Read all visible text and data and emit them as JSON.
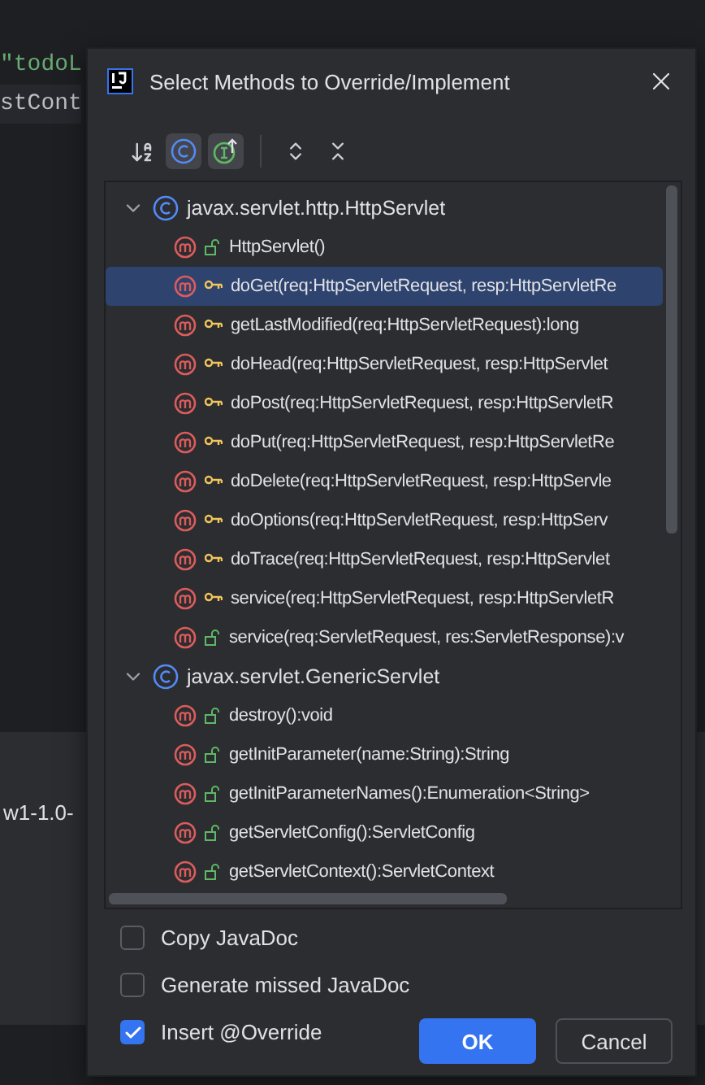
{
  "background": {
    "code_lines": [
      "\"todoL",
      "stCont"
    ],
    "console_text": "w1-1.0-"
  },
  "dialog": {
    "title": "Select Methods to Override/Implement",
    "toolbar": [
      {
        "kind": "sort",
        "selected": false
      },
      {
        "kind": "class",
        "selected": true
      },
      {
        "kind": "interface",
        "selected": true
      },
      {
        "kind": "expand",
        "selected": false
      },
      {
        "kind": "collapse",
        "selected": false
      }
    ],
    "groups": [
      {
        "name": "javax.servlet.http.HttpServlet",
        "expanded": true,
        "children": [
          {
            "label": "HttpServlet()",
            "kind": "public",
            "selected": false
          },
          {
            "label": "doGet(req:HttpServletRequest, resp:HttpServletRe",
            "kind": "protected",
            "selected": true
          },
          {
            "label": "getLastModified(req:HttpServletRequest):long",
            "kind": "protected",
            "selected": false
          },
          {
            "label": "doHead(req:HttpServletRequest, resp:HttpServlet",
            "kind": "protected",
            "selected": false
          },
          {
            "label": "doPost(req:HttpServletRequest, resp:HttpServletR",
            "kind": "protected",
            "selected": false
          },
          {
            "label": "doPut(req:HttpServletRequest, resp:HttpServletRe",
            "kind": "protected",
            "selected": false
          },
          {
            "label": "doDelete(req:HttpServletRequest, resp:HttpServle",
            "kind": "protected",
            "selected": false
          },
          {
            "label": "doOptions(req:HttpServletRequest, resp:HttpServ",
            "kind": "protected",
            "selected": false
          },
          {
            "label": "doTrace(req:HttpServletRequest, resp:HttpServlet",
            "kind": "protected",
            "selected": false
          },
          {
            "label": "service(req:HttpServletRequest, resp:HttpServletR",
            "kind": "protected",
            "selected": false
          },
          {
            "label": "service(req:ServletRequest, res:ServletResponse):v",
            "kind": "public",
            "selected": false
          }
        ]
      },
      {
        "name": "javax.servlet.GenericServlet",
        "expanded": true,
        "children": [
          {
            "label": "destroy():void",
            "kind": "public",
            "selected": false
          },
          {
            "label": "getInitParameter(name:String):String",
            "kind": "public",
            "selected": false
          },
          {
            "label": "getInitParameterNames():Enumeration<String>",
            "kind": "public",
            "selected": false
          },
          {
            "label": "getServletConfig():ServletConfig",
            "kind": "public",
            "selected": false
          },
          {
            "label": "getServletContext():ServletContext",
            "kind": "public",
            "selected": false
          }
        ]
      }
    ],
    "options": [
      {
        "label": "Copy JavaDoc",
        "checked": false
      },
      {
        "label": "Generate missed JavaDoc",
        "checked": false
      },
      {
        "label": "Insert @Override",
        "checked": true
      }
    ],
    "buttons": [
      {
        "label": "OK",
        "kind": "primary"
      },
      {
        "label": "Cancel",
        "kind": "secondary"
      }
    ]
  }
}
